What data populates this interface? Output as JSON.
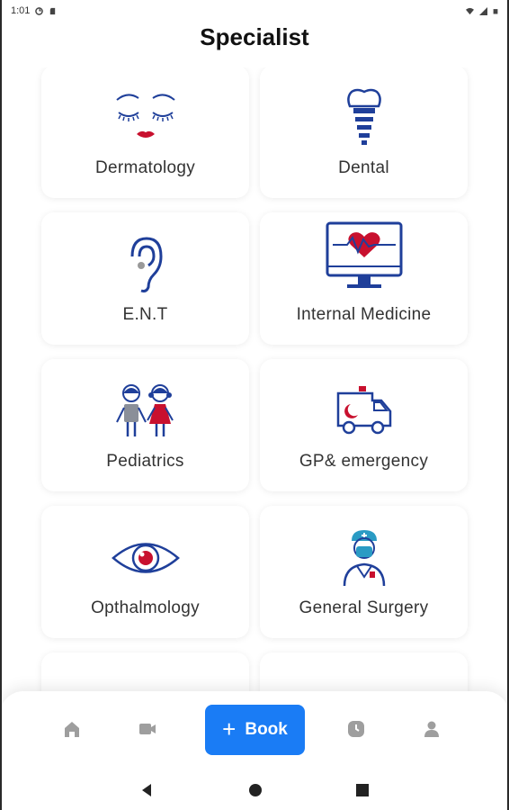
{
  "status_bar": {
    "time": "1:01"
  },
  "header": {
    "title": "Specialist"
  },
  "specialties": [
    {
      "label": "Dermatology",
      "icon": "face-icon"
    },
    {
      "label": "Dental",
      "icon": "tooth-implant-icon"
    },
    {
      "label": "E.N.T",
      "icon": "ear-icon"
    },
    {
      "label": "Internal Medicine",
      "icon": "heart-monitor-icon"
    },
    {
      "label": "Pediatrics",
      "icon": "children-icon"
    },
    {
      "label": "GP& emergency",
      "icon": "ambulance-icon"
    },
    {
      "label": "Opthalmology",
      "icon": "eye-icon"
    },
    {
      "label": "General Surgery",
      "icon": "surgeon-icon"
    }
  ],
  "bottom_nav": {
    "book_label": "Book",
    "items": [
      "home-icon",
      "video-icon",
      "book-button",
      "clock-icon",
      "profile-icon"
    ]
  },
  "colors": {
    "accent": "#1a7cf5",
    "icon_blue": "#1f3f9a",
    "icon_red": "#c8102e"
  }
}
